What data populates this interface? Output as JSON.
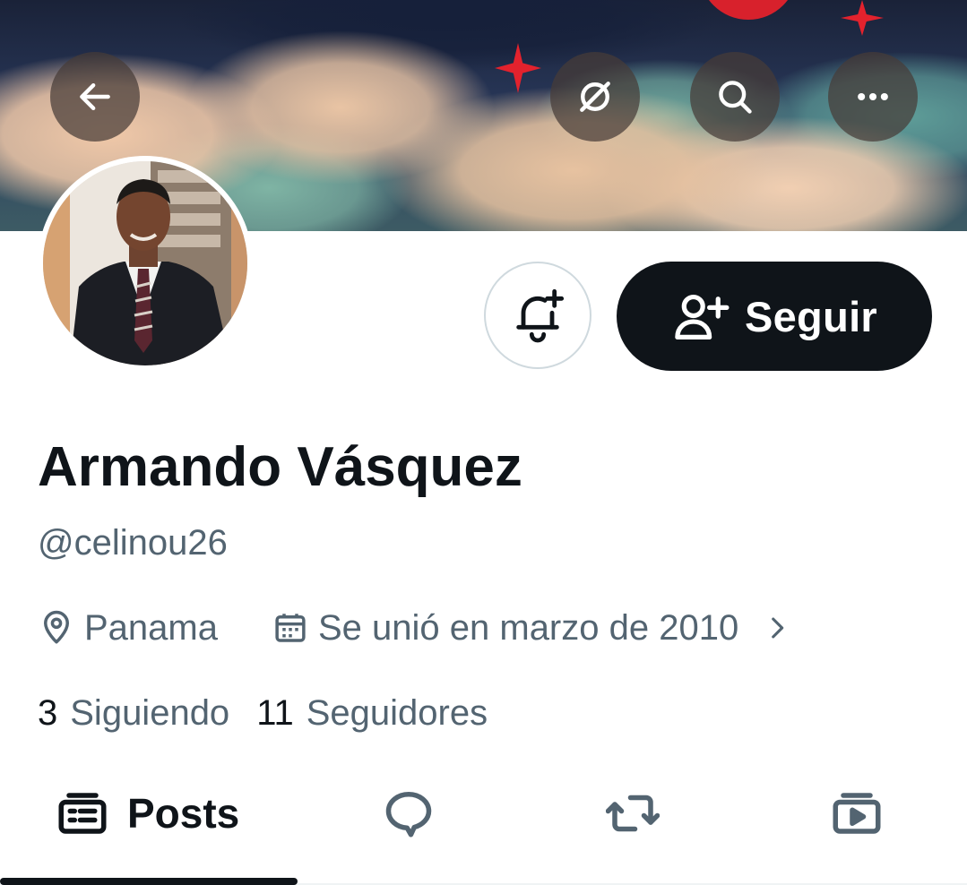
{
  "header": {
    "back_icon": "arrow-left-icon",
    "translate_icon": "grok-slash-icon",
    "search_icon": "search-icon",
    "more_icon": "more-horizontal-icon"
  },
  "profile": {
    "display_name": "Armando Vásquez",
    "handle": "@celinou26",
    "location": "Panama",
    "joined": "Se unió en marzo de 2010",
    "following_count": "3",
    "following_label": "Siguiendo",
    "followers_count": "11",
    "followers_label": "Seguidores"
  },
  "actions": {
    "notify_icon": "bell-plus-icon",
    "follow_label": "Seguir",
    "follow_icon": "person-plus-icon"
  },
  "tabs": [
    {
      "label": "Posts",
      "icon": "posts-icon",
      "active": true
    },
    {
      "label": "",
      "icon": "replies-icon",
      "active": false
    },
    {
      "label": "",
      "icon": "repost-icon",
      "active": false
    },
    {
      "label": "",
      "icon": "media-icon",
      "active": false
    }
  ],
  "colors": {
    "text_primary": "#0f1419",
    "text_secondary": "#536471",
    "border": "#cfd9de",
    "banner_accent": "#e3222d"
  }
}
